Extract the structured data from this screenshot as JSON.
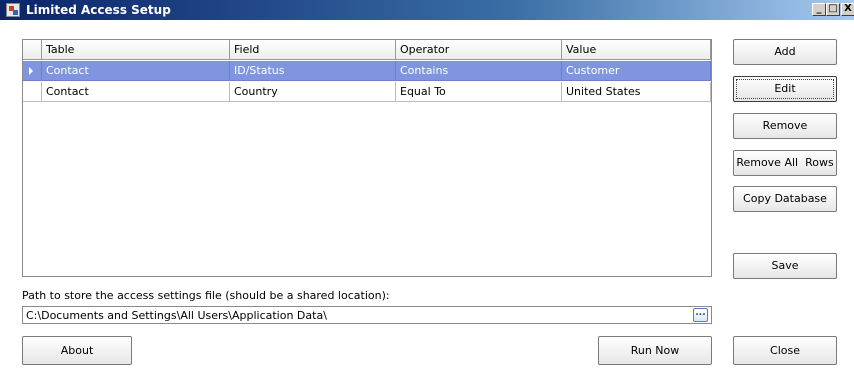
{
  "window": {
    "title": "Limited Access Setup",
    "controls": {
      "minimize": "_",
      "maximize": "□",
      "close": "X"
    }
  },
  "grid": {
    "columns": [
      "Table",
      "Field",
      "Operator",
      "Value"
    ],
    "rows": [
      {
        "table": "Contact",
        "field": "ID/Status",
        "operator": "Contains",
        "value": "Customer",
        "selected": true
      },
      {
        "table": "Contact",
        "field": "Country",
        "operator": "Equal To",
        "value": "United States",
        "selected": false
      }
    ],
    "selected_row_color": "#8095e0"
  },
  "buttons": {
    "add": "Add",
    "edit": "Edit",
    "remove": "Remove",
    "remove_all_rows": "Remove All  Rows",
    "copy_database": "Copy Database",
    "save": "Save",
    "about": "About",
    "run_now": "Run Now",
    "close": "Close",
    "browse": "..."
  },
  "path": {
    "label": "Path to store the access settings file (should be a shared location):",
    "value": "C:\\Documents and Settings\\All Users\\Application Data\\"
  },
  "icons": {
    "app": "app-icon",
    "row_indicator": "row-indicator-triangle",
    "browse": "ellipsis-icon"
  }
}
